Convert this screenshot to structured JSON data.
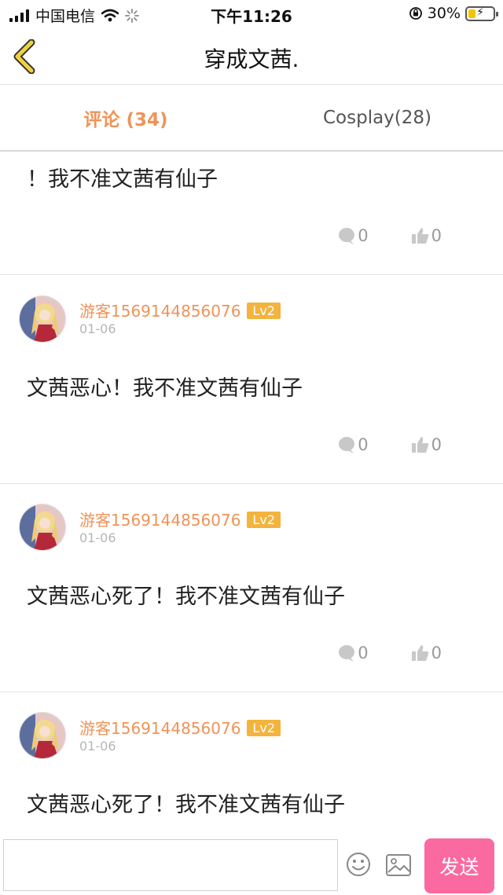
{
  "status_bar": {
    "carrier": "中国电信",
    "time": "下午11:26",
    "battery": "30%",
    "battery_level": 0.3
  },
  "nav": {
    "title": "穿成文茜."
  },
  "tabs": [
    {
      "label": "评论 (34)",
      "active": true
    },
    {
      "label": "Cosplay(28)",
      "active": false
    }
  ],
  "comments": [
    {
      "username": "",
      "level": "",
      "date": "",
      "content": "！我不准文茜有仙子",
      "reply_count": "0",
      "like_count": "0"
    },
    {
      "username": "游客1569144856076",
      "level": "Lv2",
      "date": "01-06",
      "content": "文茜恶心！我不准文茜有仙子",
      "reply_count": "0",
      "like_count": "0"
    },
    {
      "username": "游客1569144856076",
      "level": "Lv2",
      "date": "01-06",
      "content": "文茜恶心死了！我不准文茜有仙子",
      "reply_count": "0",
      "like_count": "0"
    },
    {
      "username": "游客1569144856076",
      "level": "Lv2",
      "date": "01-06",
      "content": "文茜恶心死了！我不准文茜有仙子",
      "reply_count": "",
      "like_count": ""
    }
  ],
  "composer": {
    "input_value": "",
    "send_label": "发送"
  },
  "colors": {
    "accent": "#ef9358",
    "badge": "#f3b33d",
    "send": "#fa6aa0",
    "back_chevron": "#f1d23a"
  },
  "icons": {
    "back": "chevron-left-icon",
    "reply": "comment-bubble-icon",
    "like": "thumbs-up-icon",
    "emoji": "smiley-icon",
    "image": "picture-icon",
    "wifi": "wifi-icon",
    "loading": "activity-spinner-icon",
    "lock": "orientation-lock-icon"
  }
}
